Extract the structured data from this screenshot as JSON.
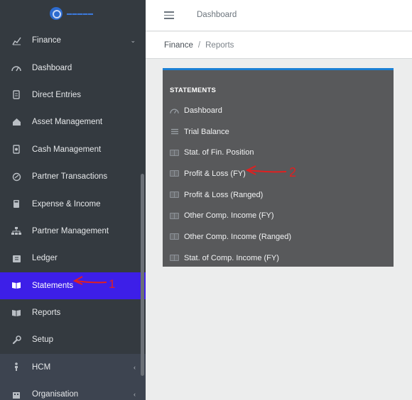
{
  "sidebar": {
    "items": [
      {
        "label": "Finance",
        "icon": "chart-icon",
        "chevron": "⌄"
      },
      {
        "label": "Dashboard",
        "icon": "gauge-icon"
      },
      {
        "label": "Direct Entries",
        "icon": "entries-icon"
      },
      {
        "label": "Asset Management",
        "icon": "home-icon"
      },
      {
        "label": "Cash Management",
        "icon": "cash-icon"
      },
      {
        "label": "Partner Transactions",
        "icon": "transactions-icon"
      },
      {
        "label": "Expense & Income",
        "icon": "calculator-icon"
      },
      {
        "label": "Partner Management",
        "icon": "sitemap-icon"
      },
      {
        "label": "Ledger",
        "icon": "ledger-icon"
      },
      {
        "label": "Statements",
        "icon": "book-icon"
      },
      {
        "label": "Reports",
        "icon": "book-open-icon"
      },
      {
        "label": "Setup",
        "icon": "wrench-icon"
      },
      {
        "label": "HCM",
        "icon": "person-icon",
        "chevron": "‹"
      },
      {
        "label": "Organisation",
        "icon": "building-icon",
        "chevron": "‹"
      }
    ],
    "active_item": "Statements",
    "accent_color": "#3d1fe8"
  },
  "header": {
    "title": "Dashboard"
  },
  "breadcrumb": {
    "parent": "Finance",
    "separator": "/",
    "current": "Reports"
  },
  "card": {
    "title": "STATEMENTS",
    "items": [
      {
        "label": "Dashboard",
        "icon": "gauge-icon"
      },
      {
        "label": "Trial Balance",
        "icon": "list-icon"
      },
      {
        "label": "Stat. of Fin. Position",
        "icon": "book-icon"
      },
      {
        "label": "Profit & Loss (FY)",
        "icon": "book-icon"
      },
      {
        "label": "Profit & Loss (Ranged)",
        "icon": "book-icon"
      },
      {
        "label": "Other Comp. Income (FY)",
        "icon": "book-icon"
      },
      {
        "label": "Other Comp. Income (Ranged)",
        "icon": "book-icon"
      },
      {
        "label": "Stat. of Comp. Income (FY)",
        "icon": "book-icon"
      }
    ]
  },
  "annotations": {
    "arrow_1_label": "1",
    "arrow_2_label": "2",
    "color": "#e02020"
  }
}
